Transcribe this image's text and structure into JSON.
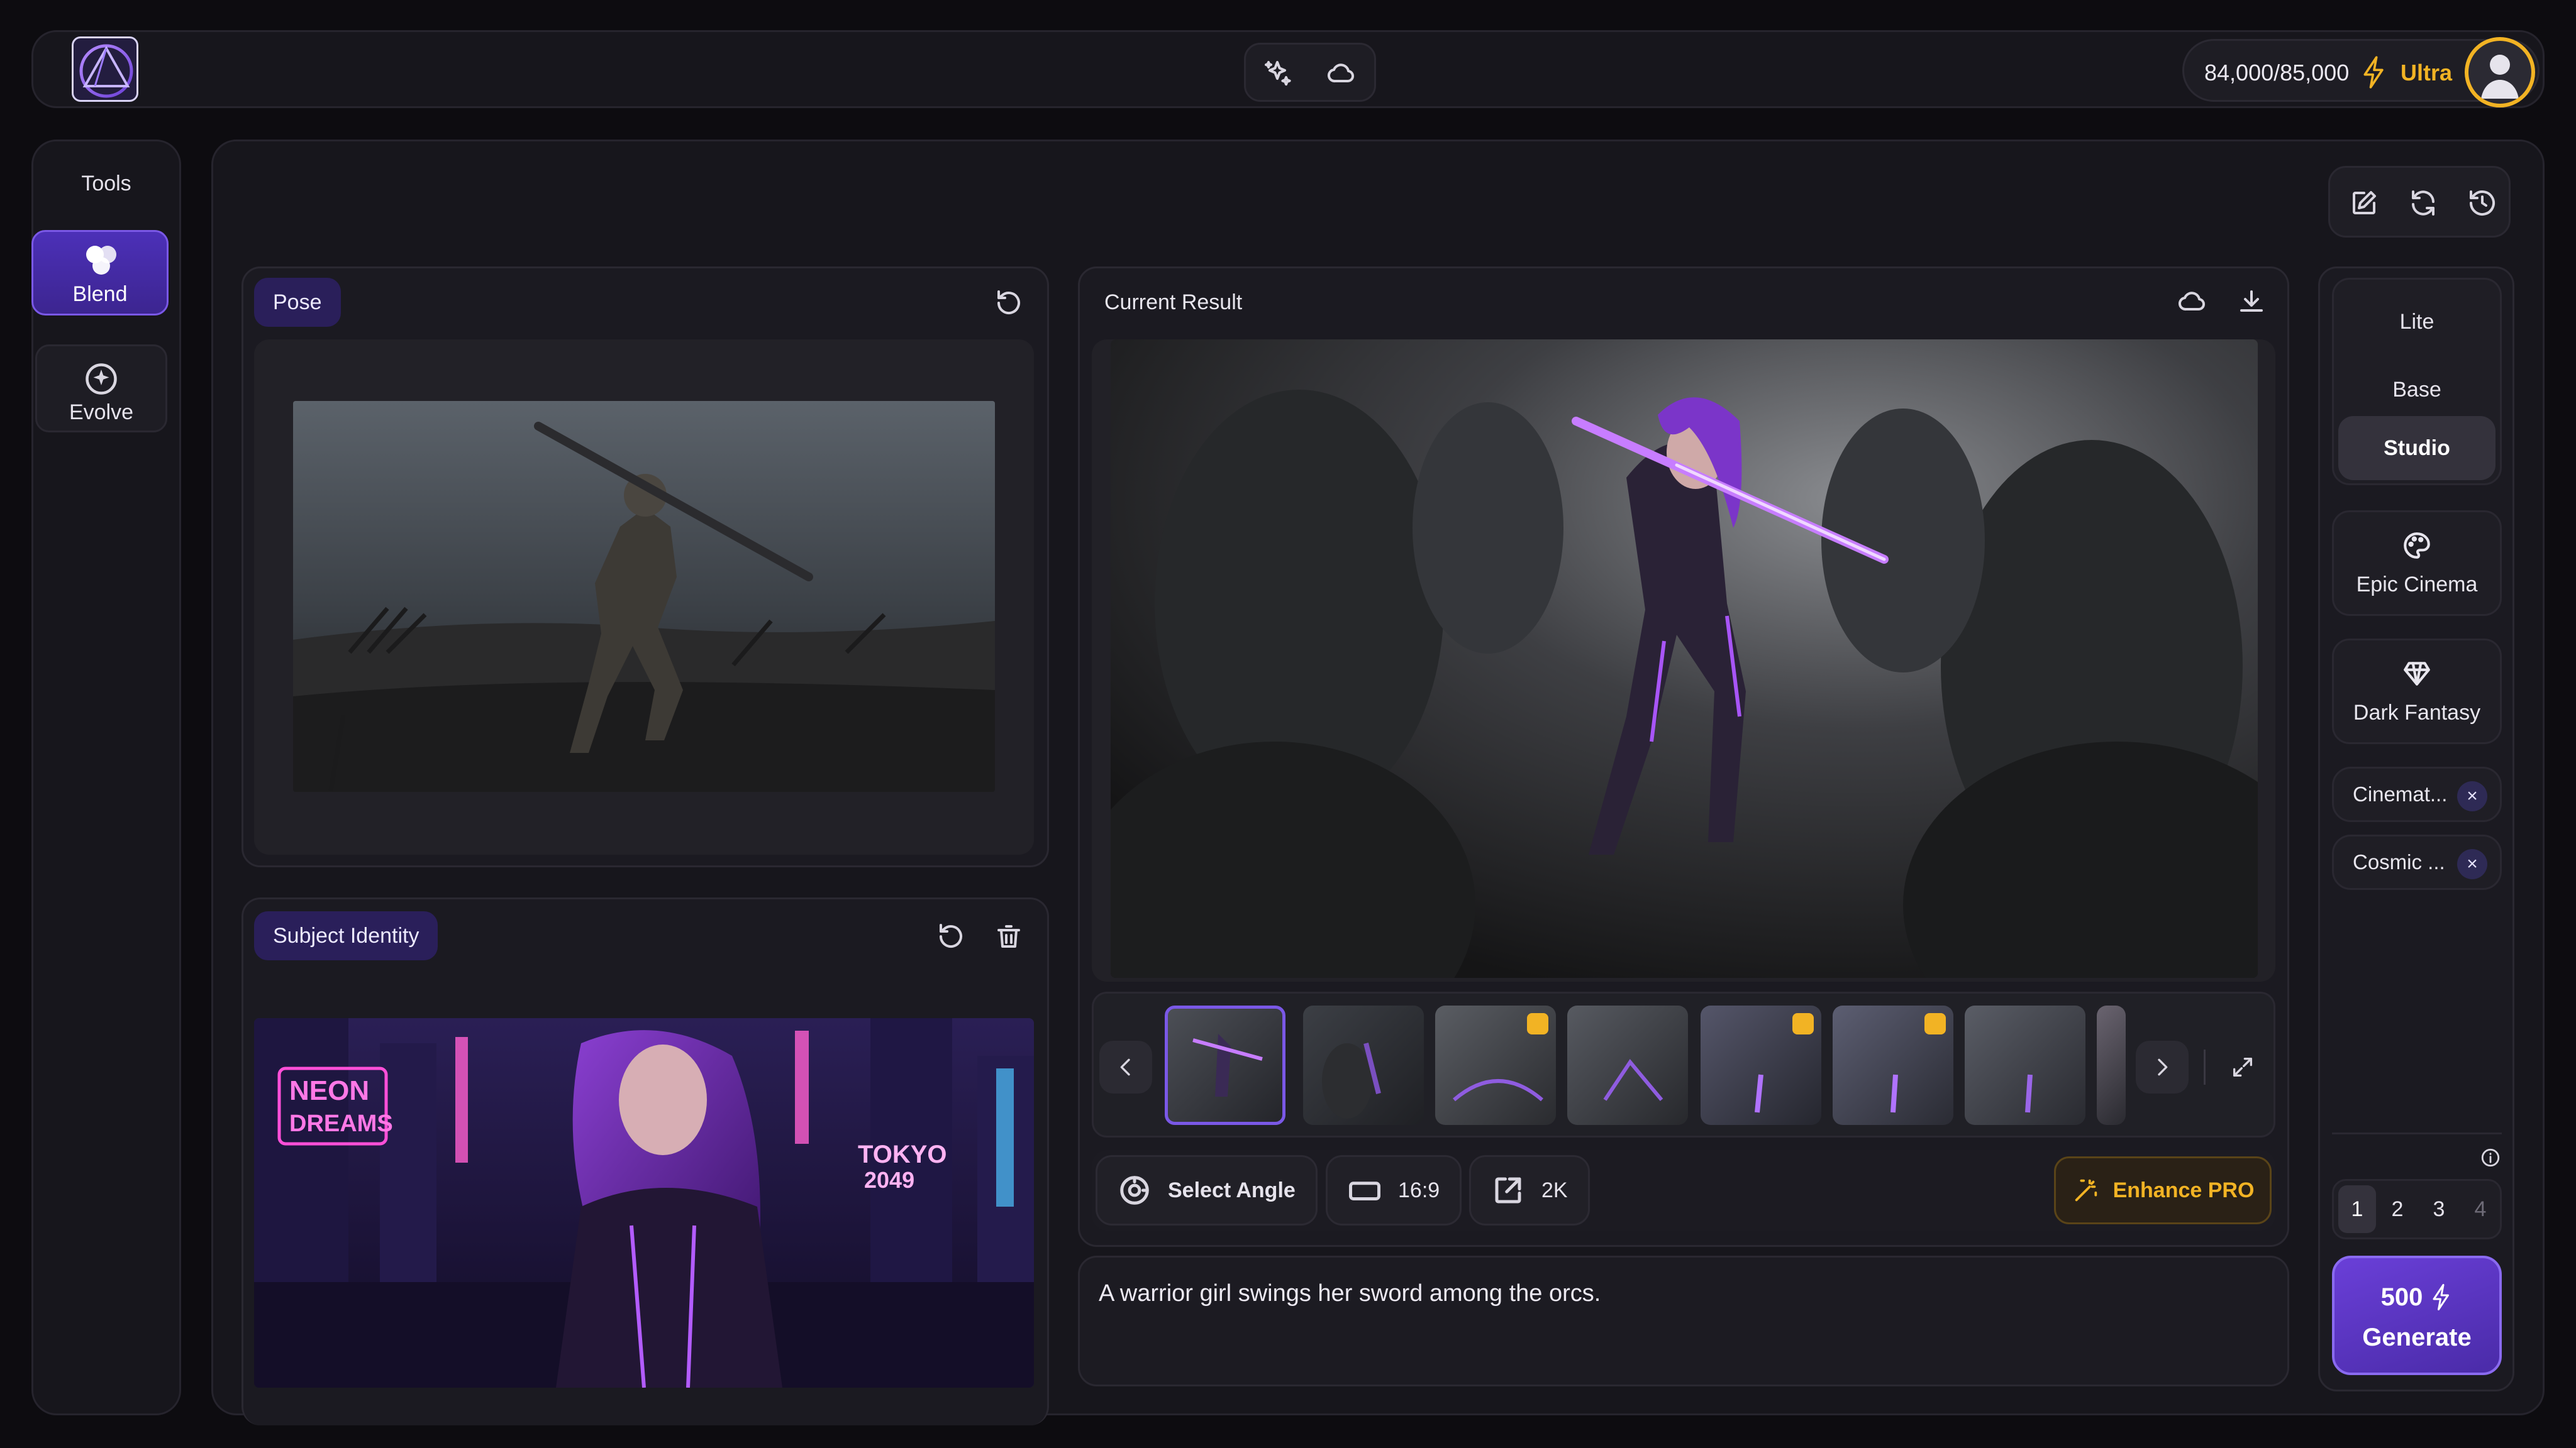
{
  "header": {
    "credits": "84,000/85,000",
    "plan": "Ultra"
  },
  "tools": {
    "title": "Tools",
    "items": [
      {
        "label": "Blend",
        "icon": "blend-circles-icon",
        "active": true
      },
      {
        "label": "Evolve",
        "icon": "evolve-sparkle-icon",
        "active": false
      }
    ]
  },
  "pose": {
    "tag": "Pose"
  },
  "subject": {
    "tag": "Subject Identity",
    "sign_text_1": "NEON",
    "sign_text_2": "DREAMS",
    "sign_text_3": "TOKYO",
    "sign_text_4": "2049"
  },
  "result": {
    "title": "Current Result",
    "thumbnails": [
      {
        "selected": true,
        "pro": false
      },
      {
        "selected": false,
        "pro": false
      },
      {
        "selected": false,
        "pro": true
      },
      {
        "selected": false,
        "pro": false
      },
      {
        "selected": false,
        "pro": true
      },
      {
        "selected": false,
        "pro": true
      },
      {
        "selected": false,
        "pro": false
      }
    ]
  },
  "toolbar": {
    "select_angle": "Select Angle",
    "aspect": "16:9",
    "resolution": "2K",
    "enhance": "Enhance PRO"
  },
  "prompt": {
    "text": "A warrior girl swings her sword among the orcs."
  },
  "quality": {
    "options": [
      "Lite",
      "Base",
      "Studio"
    ],
    "selected": "Studio"
  },
  "styles": {
    "cards": [
      {
        "label": "Epic Cinema",
        "icon": "palette-icon"
      },
      {
        "label": "Dark Fantasy",
        "icon": "diamond-icon"
      }
    ],
    "pills": [
      "Cinemat...",
      "Cosmic ..."
    ]
  },
  "count": {
    "options": [
      "1",
      "2",
      "3",
      "4"
    ],
    "selected": "1"
  },
  "generate": {
    "cost": "500",
    "label": "Generate"
  },
  "colors": {
    "accent": "#6b3fd6",
    "gold": "#f2b324",
    "background": "#0d0c10"
  }
}
